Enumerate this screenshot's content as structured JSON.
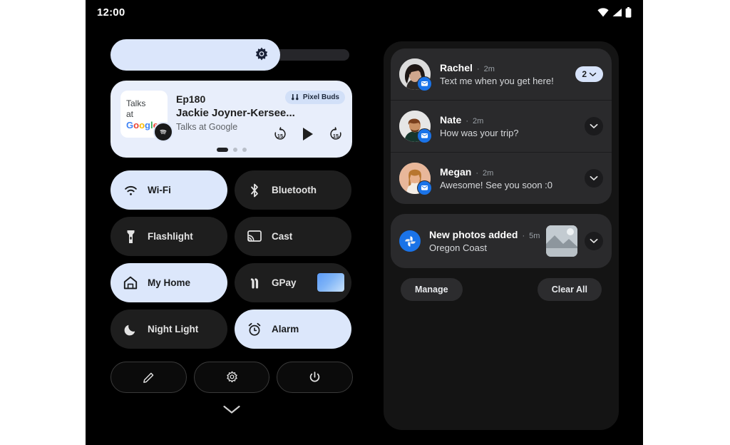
{
  "statusbar": {
    "clock": "12:00",
    "icons": [
      "wifi-icon",
      "cellular-signal-icon",
      "battery-icon"
    ]
  },
  "brightness": {
    "name": "brightness-slider",
    "icon": "brightness-icon",
    "fill_percent": 71
  },
  "media": {
    "album_art_lines": [
      "Talks",
      "at",
      "Google"
    ],
    "app_badge": "spotify-icon",
    "episode": "Ep180",
    "title": "Jackie Joyner-Kersee...",
    "artist": "Talks at Google",
    "output_chip": {
      "label": "Pixel Buds",
      "icon": "earbuds-icon"
    },
    "controls": [
      {
        "name": "rewind-15-button",
        "label": "15"
      },
      {
        "name": "play-button",
        "label": ""
      },
      {
        "name": "forward-15-button",
        "label": "15"
      }
    ],
    "page_dots": {
      "count": 3,
      "active_index": 0
    }
  },
  "tiles": [
    {
      "label": "Wi-Fi",
      "icon": "wifi-icon",
      "state": "on"
    },
    {
      "label": "Bluetooth",
      "icon": "bluetooth-icon",
      "state": "off"
    },
    {
      "label": "Flashlight",
      "icon": "flashlight-icon",
      "state": "off"
    },
    {
      "label": "Cast",
      "icon": "cast-icon",
      "state": "off"
    },
    {
      "label": "My Home",
      "icon": "home-icon",
      "state": "on"
    },
    {
      "label": "GPay",
      "icon": "gpay-icon",
      "state": "off",
      "thumbnail": "payment-card-thumbnail"
    },
    {
      "label": "Night Light",
      "icon": "moon-icon",
      "state": "off"
    },
    {
      "label": "Alarm",
      "icon": "alarm-clock-icon",
      "state": "on"
    }
  ],
  "footer_buttons": [
    {
      "name": "edit-tiles-button",
      "icon": "pencil-icon"
    },
    {
      "name": "settings-button",
      "icon": "gear-icon"
    },
    {
      "name": "power-button",
      "icon": "power-icon"
    }
  ],
  "collapse": {
    "icon": "chevron-down-icon"
  },
  "notifications": {
    "messages": [
      {
        "name": "Rachel",
        "separator": "·",
        "time": "2m",
        "message": "Text me when you get here!",
        "app_badge": "messages-icon",
        "count": "2",
        "action": "count-chevron-pill"
      },
      {
        "name": "Nate",
        "separator": "·",
        "time": "2m",
        "message": "How was your trip?",
        "app_badge": "messages-icon",
        "action": "expand-chevron-button"
      },
      {
        "name": "Megan",
        "separator": "·",
        "time": "2m",
        "message": "Awesome! See you soon :0",
        "app_badge": "messages-icon",
        "action": "expand-chevron-button"
      }
    ],
    "photos": {
      "title": "New photos added",
      "separator": "·",
      "time": "5m",
      "subtitle": "Oregon Coast",
      "icon": "google-photos-icon",
      "thumbnail": "photo-thumbnail",
      "action": "expand-chevron-button"
    },
    "actions": {
      "manage": "Manage",
      "clear_all": "Clear All"
    }
  },
  "colors": {
    "accent_light": "#dce7fb",
    "screen_bg": "#000000",
    "tile_off": "#1e1e1e",
    "shade_bg": "#141414",
    "notif_bg": "#2a2a2c",
    "blue_badge": "#1a73e8"
  }
}
